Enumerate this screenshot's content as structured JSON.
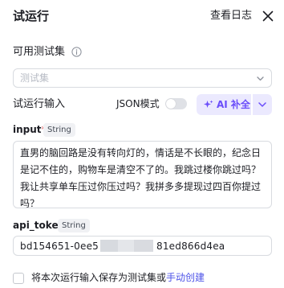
{
  "header": {
    "title": "试运行",
    "log_link": "查看日志"
  },
  "testset": {
    "label": "可用测试集",
    "placeholder": "测试集"
  },
  "run_input": {
    "label": "试运行输入",
    "json_mode_label": "JSON模式",
    "json_mode_on": false,
    "ai_button_label": "AI 补全",
    "accent_color": "#6a4dfa"
  },
  "fields": [
    {
      "name": "input",
      "required_mark": "*",
      "type": "String",
      "value": "直男的脑回路是没有转向灯的，情话是不长眼的，纪念日是记不住的，购物车是清空不了的。我跳过楼你跳过吗？我让共享单车压过你压过吗？我拼多多提现过四百你提过吗？"
    },
    {
      "name": "api_token",
      "type": "String",
      "value_start": "bd154651-0ee5",
      "value_end": "81ed866d4ea"
    }
  ],
  "footer": {
    "save_text": "将本次运行输入保存为测试集或",
    "manual_link": "手动创建",
    "checked": false
  }
}
